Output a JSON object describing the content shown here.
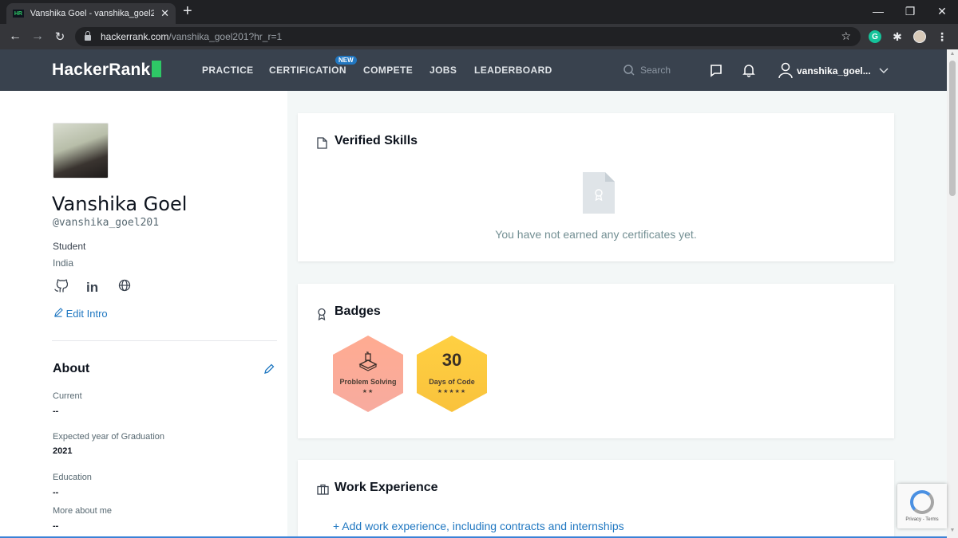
{
  "browser": {
    "tab_title": "Vanshika Goel - vanshika_goel20",
    "tab_favicon": "HR",
    "url_host": "hackerrank.com",
    "url_path": "/vanshika_goel201?hr_r=1",
    "ext_grammarly": "G"
  },
  "nav": {
    "logo": "HackerRank",
    "links": [
      "PRACTICE",
      "CERTIFICATION",
      "COMPETE",
      "JOBS",
      "LEADERBOARD"
    ],
    "new_badge": "NEW",
    "search_placeholder": "Search",
    "username": "vanshika_goel..."
  },
  "profile": {
    "name": "Vanshika Goel",
    "handle": "@vanshika_goel201",
    "role": "Student",
    "country": "India",
    "edit_intro": "Edit Intro",
    "social": [
      "github-icon",
      "linkedin-icon",
      "globe-icon"
    ],
    "linkedin_label": "in"
  },
  "about": {
    "title": "About",
    "fields": [
      {
        "label": "Current",
        "value": "--"
      },
      {
        "label": "Expected year of Graduation",
        "value": "2021"
      },
      {
        "label": "Education",
        "value": "--"
      },
      {
        "label": "More about me",
        "value": "--"
      }
    ]
  },
  "verified_skills": {
    "title": "Verified Skills",
    "empty_text": "You have not earned any certificates yet."
  },
  "badges": {
    "title": "Badges",
    "items": [
      {
        "name": "Problem Solving",
        "stars": "★★",
        "star_count": 2,
        "color": "#ffab91"
      },
      {
        "name": "Days of Code",
        "number": "30",
        "stars": "★★★★★",
        "star_count": 5,
        "color": "#ffd042"
      }
    ]
  },
  "work": {
    "title": "Work Experience",
    "add_link": "+ Add work experience, including contracts and internships"
  },
  "recaptcha": {
    "text": "Privacy - Terms"
  },
  "colors": {
    "nav_bg": "#39424e",
    "brand_green": "#2ec866",
    "link_blue": "#1f77c1"
  }
}
